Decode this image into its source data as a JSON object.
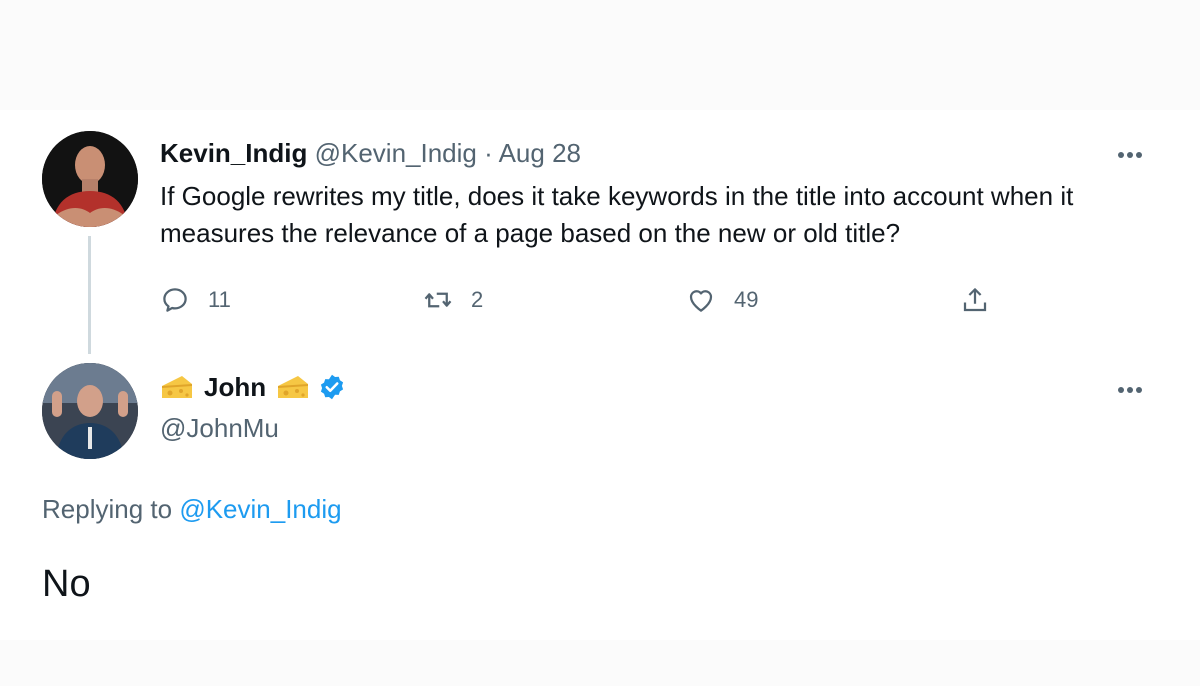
{
  "tweet": {
    "author_name": "Kevin_Indig",
    "author_handle": "@Kevin_Indig",
    "separator": "·",
    "date": "Aug 28",
    "text": "If Google rewrites my title, does it take keywords in the title into account when it measures the relevance of a page based on the new or old title?",
    "reply_count": "11",
    "retweet_count": "2",
    "like_count": "49",
    "icons": [
      "reply-icon",
      "retweet-icon",
      "heart-icon",
      "share-icon",
      "more-icon"
    ]
  },
  "reply": {
    "author_name": "John",
    "author_handle": "@JohnMu",
    "replying_prefix": "Replying to",
    "replying_to": "@Kevin_Indig",
    "text": "No",
    "icons": [
      "cheese-icon",
      "verified-badge-icon",
      "more-icon"
    ]
  },
  "colors": {
    "text_primary": "#0f1419",
    "text_secondary": "#536471",
    "link": "#1d9bf0",
    "thread_line": "#cfd9de"
  }
}
